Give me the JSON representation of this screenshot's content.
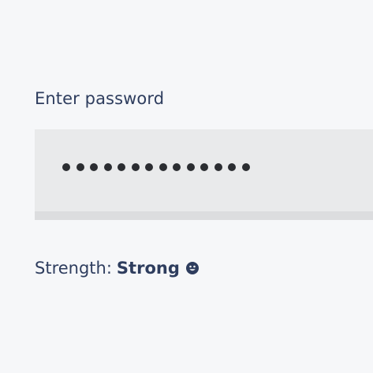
{
  "password_field": {
    "label": "Enter password",
    "masked_length": 14
  },
  "strength": {
    "prefix": "Strength:",
    "value": "Strong",
    "icon": "smiley-icon"
  },
  "colors": {
    "background": "#f6f7f9",
    "text": "#2e3d5e",
    "field_bg": "#e9eaeb",
    "field_bottom_bar": "#dcdddf",
    "mask_dot": "#2b2d31"
  }
}
